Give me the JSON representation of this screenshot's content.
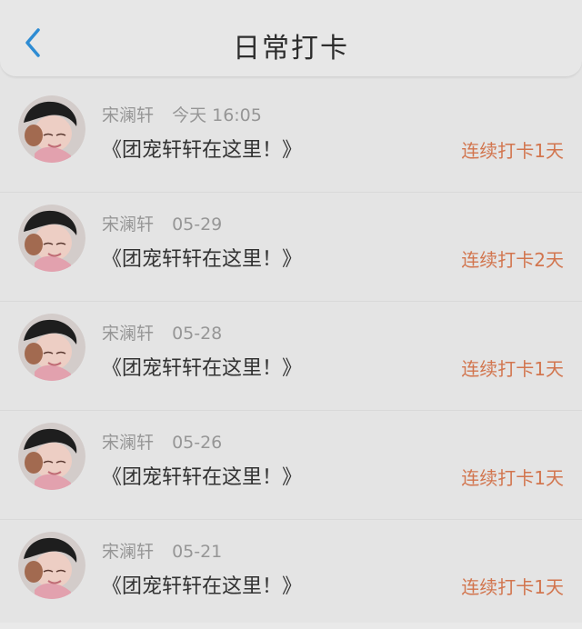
{
  "colors": {
    "background": "#e9e9e9",
    "accent_back": "#2f8fd8",
    "streak_text": "#d77850",
    "meta_text": "#9a9a9a",
    "content_text": "#333333"
  },
  "header": {
    "title": "日常打卡",
    "back_icon": "chevron-left-icon"
  },
  "checkins": [
    {
      "name": "宋澜轩",
      "time": "今天 16:05",
      "content": "《团宠轩轩在这里！》",
      "streak": "连续打卡1天"
    },
    {
      "name": "宋澜轩",
      "time": "05-29",
      "content": "《团宠轩轩在这里！》",
      "streak": "连续打卡2天"
    },
    {
      "name": "宋澜轩",
      "time": "05-28",
      "content": "《团宠轩轩在这里！》",
      "streak": "连续打卡1天"
    },
    {
      "name": "宋澜轩",
      "time": "05-26",
      "content": "《团宠轩轩在这里！》",
      "streak": "连续打卡1天"
    },
    {
      "name": "宋澜轩",
      "time": "05-21",
      "content": "《团宠轩轩在这里！》",
      "streak": "连续打卡1天"
    }
  ]
}
